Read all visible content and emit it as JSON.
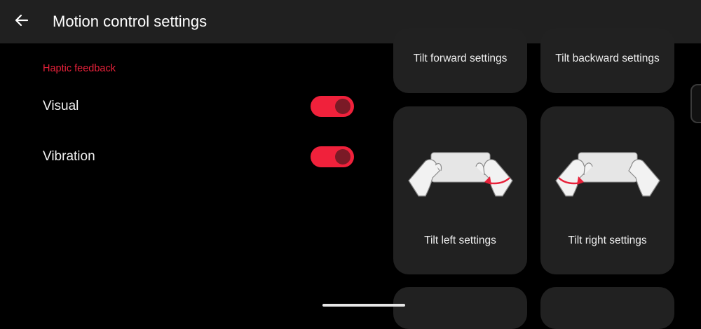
{
  "header": {
    "title": "Motion control settings"
  },
  "haptic": {
    "section_title": "Haptic feedback",
    "items": [
      {
        "label": "Visual",
        "enabled": true
      },
      {
        "label": "Vibration",
        "enabled": true
      }
    ]
  },
  "cards": [
    {
      "label": "Tilt forward settings"
    },
    {
      "label": "Tilt backward settings"
    },
    {
      "label": "Tilt left settings"
    },
    {
      "label": "Tilt right settings"
    }
  ],
  "colors": {
    "accent": "#f0213b",
    "toolbar": "#202020",
    "card": "#212121",
    "background": "#000000"
  },
  "icons": {
    "back": "arrow-left-icon",
    "tilt_left": "hands-tilt-left-icon",
    "tilt_right": "hands-tilt-right-icon"
  }
}
